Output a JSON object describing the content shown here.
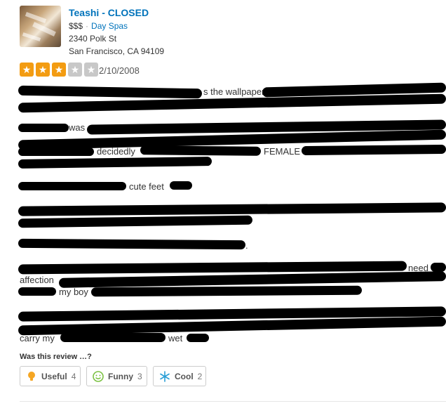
{
  "business": {
    "name": "Teashi - CLOSED",
    "price": "$$$",
    "category": "Day Spas",
    "address_line1": "2340 Polk St",
    "address_line2": "San Francisco, CA 94109"
  },
  "review": {
    "rating": 3,
    "rating_max": 5,
    "date": "2/10/2008",
    "visible_fragments": {
      "wallpaper": "s the wallpaper.",
      "was": "was",
      "decidedly": "decidedly",
      "female": "FEMALE",
      "cute_feet": "cute feet",
      "period": ".",
      "need": "need",
      "affection": "affection",
      "my_boy": "my boy",
      "carry_my": "carry my",
      "wet": "wet"
    }
  },
  "feedback": {
    "prompt": "Was this review …?",
    "useful_label": "Useful",
    "useful_count": "4",
    "funny_label": "Funny",
    "funny_count": "3",
    "cool_label": "Cool",
    "cool_count": "2"
  },
  "colors": {
    "link": "#0073bb",
    "star_on": "#f39c12",
    "star_off": "#c8c8c8",
    "redaction": "#000000"
  }
}
